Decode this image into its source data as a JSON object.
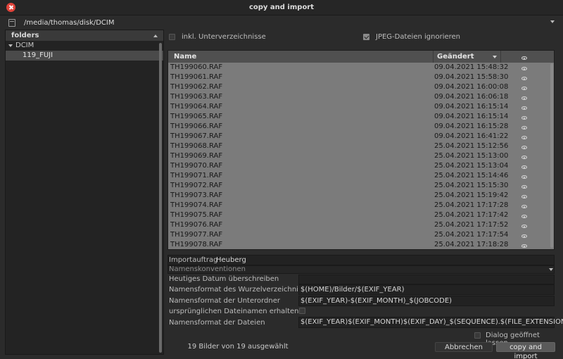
{
  "window": {
    "title": "copy and import"
  },
  "path": {
    "value": "/media/thomas/disk/DCIM"
  },
  "folders": {
    "header": "folders",
    "root": "DCIM",
    "child": "119_FUJI"
  },
  "options": {
    "recursive_label": "inkl. Unterverzeichnisse",
    "recursive_checked": false,
    "ignore_jpeg_label": "JPEG-Dateien ignorieren",
    "ignore_jpeg_checked": true
  },
  "table": {
    "headers": {
      "name": "Name",
      "changed": "Geändert"
    },
    "rows": [
      {
        "name": "TH199060.RAF",
        "date": "09.04.2021 15:48:32"
      },
      {
        "name": "TH199061.RAF",
        "date": "09.04.2021 15:58:30"
      },
      {
        "name": "TH199062.RAF",
        "date": "09.04.2021 16:00:08"
      },
      {
        "name": "TH199063.RAF",
        "date": "09.04.2021 16:06:18"
      },
      {
        "name": "TH199064.RAF",
        "date": "09.04.2021 16:15:14"
      },
      {
        "name": "TH199065.RAF",
        "date": "09.04.2021 16:15:14"
      },
      {
        "name": "TH199066.RAF",
        "date": "09.04.2021 16:15:28"
      },
      {
        "name": "TH199067.RAF",
        "date": "09.04.2021 16:41:22"
      },
      {
        "name": "TH199068.RAF",
        "date": "25.04.2021 15:12:56"
      },
      {
        "name": "TH199069.RAF",
        "date": "25.04.2021 15:13:00"
      },
      {
        "name": "TH199070.RAF",
        "date": "25.04.2021 15:13:04"
      },
      {
        "name": "TH199071.RAF",
        "date": "25.04.2021 15:14:46"
      },
      {
        "name": "TH199072.RAF",
        "date": "25.04.2021 15:15:30"
      },
      {
        "name": "TH199073.RAF",
        "date": "25.04.2021 15:19:42"
      },
      {
        "name": "TH199074.RAF",
        "date": "25.04.2021 17:17:28"
      },
      {
        "name": "TH199075.RAF",
        "date": "25.04.2021 17:17:42"
      },
      {
        "name": "TH199076.RAF",
        "date": "25.04.2021 17:17:52"
      },
      {
        "name": "TH199077.RAF",
        "date": "25.04.2021 17:17:54"
      },
      {
        "name": "TH199078.RAF",
        "date": "25.04.2021 17:18:28"
      }
    ]
  },
  "form": {
    "job_label": "Importauftrag",
    "job_value": "Heuberg",
    "naming_placeholder": "Namenskonventionen",
    "override_date_label": "Heutiges Datum überschreiben",
    "root_format_label": "Namensformat des Wurzelverzeichnisses",
    "root_format_value": "$(HOME)/Bilder/$(EXIF_YEAR)",
    "sub_format_label": "Namensformat der Unterordner",
    "sub_format_value": "$(EXIF_YEAR)-$(EXIF_MONTH)_$(JOBCODE)",
    "keep_name_label": "ursprünglichen Dateinamen erhalten",
    "file_format_label": "Namensformat der Dateien",
    "file_format_value": "$(EXIF_YEAR)$(EXIF_MONTH)$(EXIF_DAY)_$(SEQUENCE).$(FILE_EXTENSION)"
  },
  "footer": {
    "keep_open_label": "Dialog geöffnet lassen",
    "status": "19 Bilder von 19 ausgewählt",
    "cancel": "Abbrechen",
    "ok": "copy and import"
  }
}
